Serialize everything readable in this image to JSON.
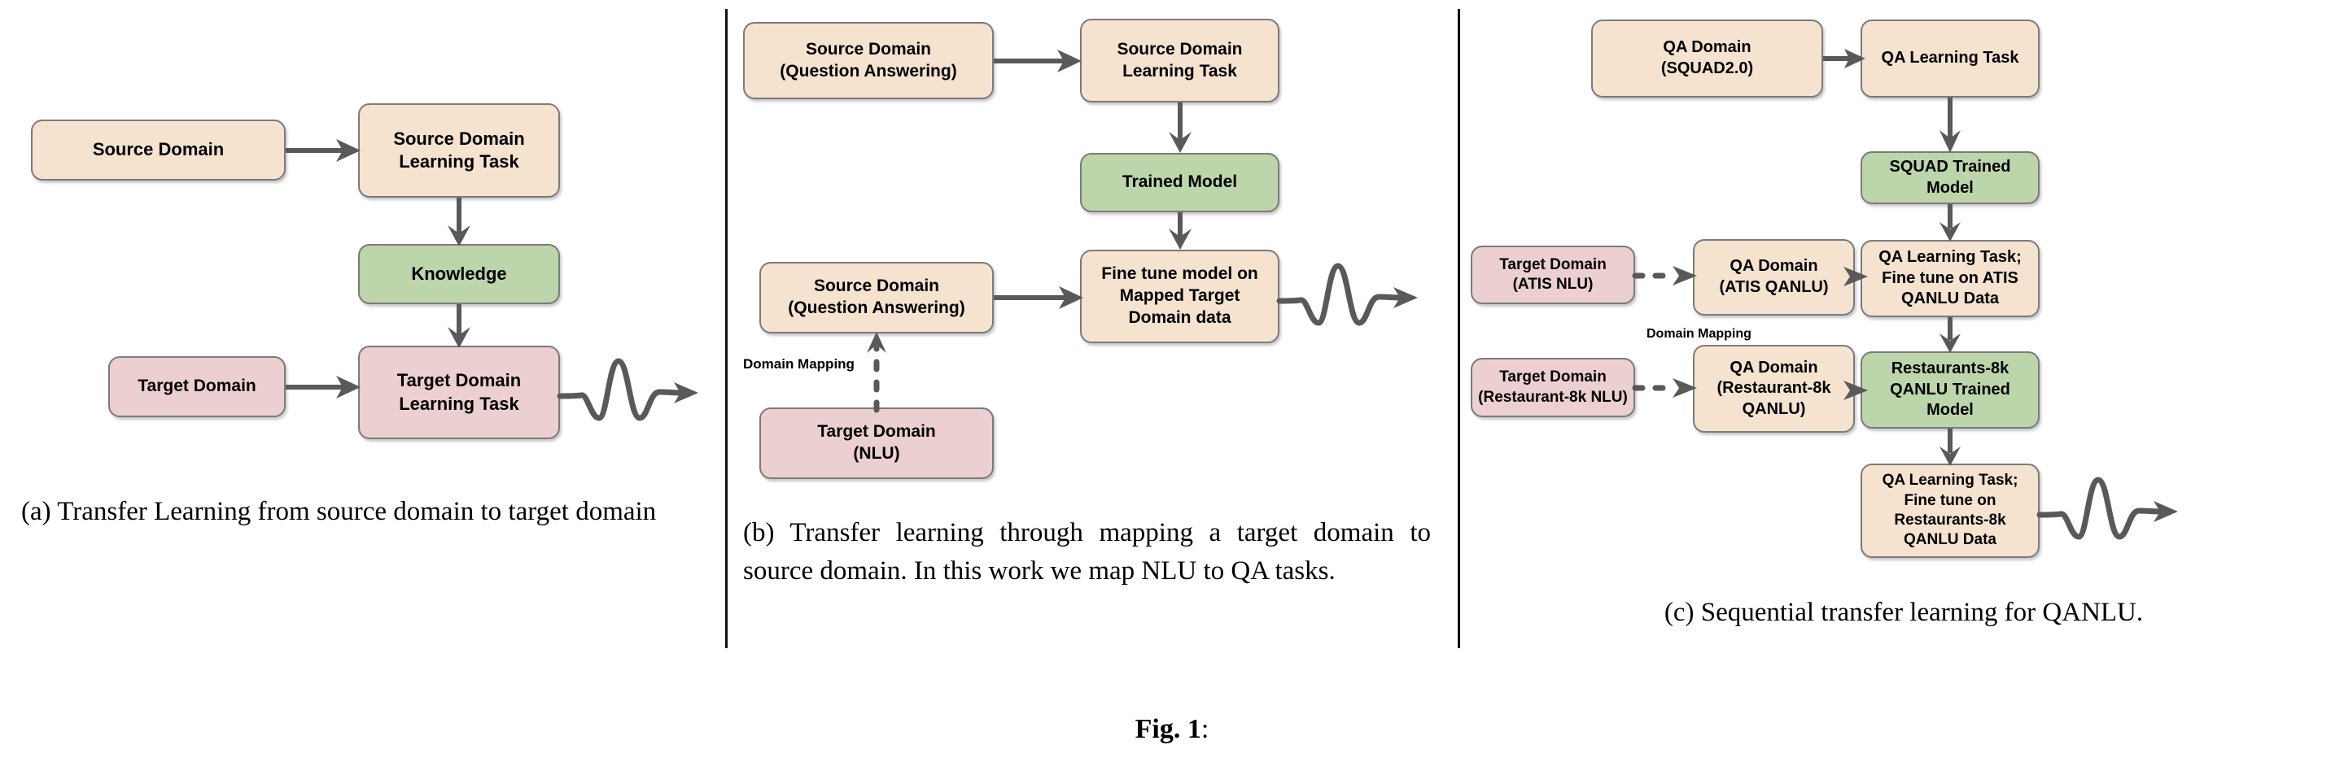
{
  "figure": {
    "label_name": "Fig. 1",
    "label_colon": ":"
  },
  "panels": [
    {
      "id": "a",
      "caption": "(a) Transfer Learning from source domain to target domain",
      "nodes": {
        "source_domain": "Source Domain",
        "source_domain_learning_task": "Source Domain\nLearning Task",
        "knowledge": "Knowledge",
        "target_domain": "Target Domain",
        "target_domain_learning_task": "Target Domain\nLearning Task"
      }
    },
    {
      "id": "b",
      "caption": "(b) Transfer learning through mapping a target domain to source domain.  In this work we map NLU to QA tasks.",
      "nodes": {
        "source_domain_qa_top": "Source Domain\n(Question Answering)",
        "source_domain_learning_task": "Source Domain\nLearning Task",
        "trained_model": "Trained Model",
        "source_domain_qa_bottom": "Source Domain\n(Question Answering)",
        "fine_tune_model": "Fine tune model on\nMapped Target\nDomain data",
        "target_domain_nlu": "Target Domain\n(NLU)"
      },
      "edge_labels": {
        "domain_mapping": "Domain Mapping"
      }
    },
    {
      "id": "c",
      "caption": "(c) Sequential transfer learning for QANLU.",
      "nodes": {
        "qa_domain_squad": "QA Domain\n(SQUAD2.0)",
        "qa_learning_task": "QA Learning Task",
        "squad_trained_model": "SQUAD Trained\nModel",
        "target_domain_atis": "Target Domain\n(ATIS NLU)",
        "qa_domain_atis": "QA Domain\n(ATIS QANLU)",
        "qa_learning_task_atis": "QA Learning Task;\nFine tune on ATIS\nQANLU Data",
        "target_domain_restaurant": "Target Domain\n(Restaurant-8k NLU)",
        "qa_domain_restaurant": "QA Domain\n(Restaurant-8k\nQANLU)",
        "restaurants_trained_model": "Restaurants-8k\nQANLU Trained\nModel",
        "qa_learning_task_restaurant": "QA Learning Task;\nFine tune on\nRestaurants-8k\nQANLU Data"
      },
      "edge_labels": {
        "domain_mapping": "Domain Mapping"
      }
    }
  ],
  "colors": {
    "peach": "#f5e3d0",
    "green": "#bdd5ab",
    "pink": "#eccfd0",
    "node_border": "#7b7b7b",
    "connector": "#595959",
    "divider": "#111111",
    "text": "#000000",
    "background": "#ffffff"
  }
}
